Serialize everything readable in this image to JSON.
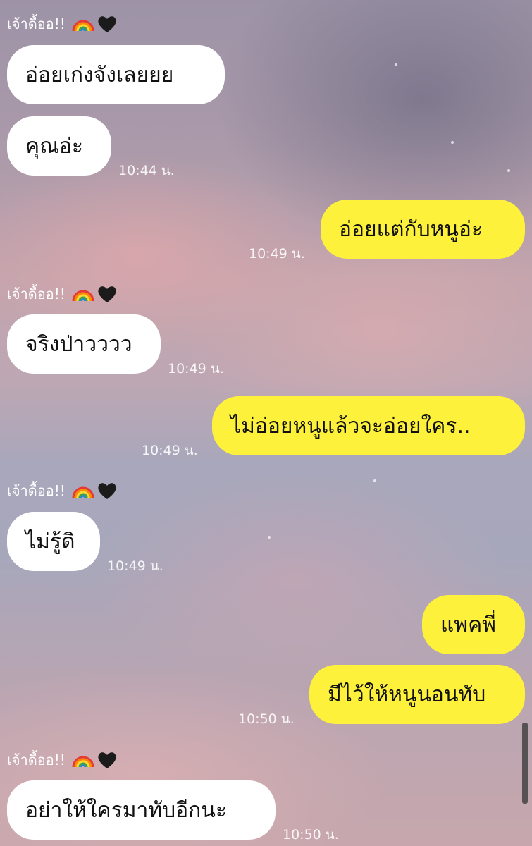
{
  "chat": {
    "sender_name": "เจ้าดื้ออ!!",
    "sender_icons": [
      "rainbow-emoji",
      "black-heart-emoji"
    ],
    "messages": [
      {
        "side": "in",
        "text": "อ่อยเก่งจังเลยยย",
        "time": ""
      },
      {
        "side": "in",
        "text": "คุณอ่ะ",
        "time": "10:44 น."
      },
      {
        "side": "out",
        "text": "อ่อยแต่กับหนูอ่ะ",
        "time": "10:49 น."
      },
      {
        "side": "in",
        "text": "จริงป่าวววว",
        "time": "10:49 น."
      },
      {
        "side": "out",
        "text": "ไม่อ่อยหนูแล้วจะอ่อยใคร..",
        "time": "10:49 น."
      },
      {
        "side": "in",
        "text": "ไม่รู้ดิ",
        "time": "10:49 น."
      },
      {
        "side": "out",
        "text": "แพคพี่",
        "time": ""
      },
      {
        "side": "out",
        "text": "มีไว้ให้หนูนอนทับ",
        "time": "10:50 น."
      },
      {
        "side": "in",
        "text": "อย่าให้ใครมาทับอีกนะ",
        "time": "10:50 น."
      }
    ]
  },
  "colors": {
    "incoming_bubble": "#ffffff",
    "outgoing_bubble": "#fdf13b",
    "text": "#111111",
    "meta_text": "#ffffff"
  }
}
